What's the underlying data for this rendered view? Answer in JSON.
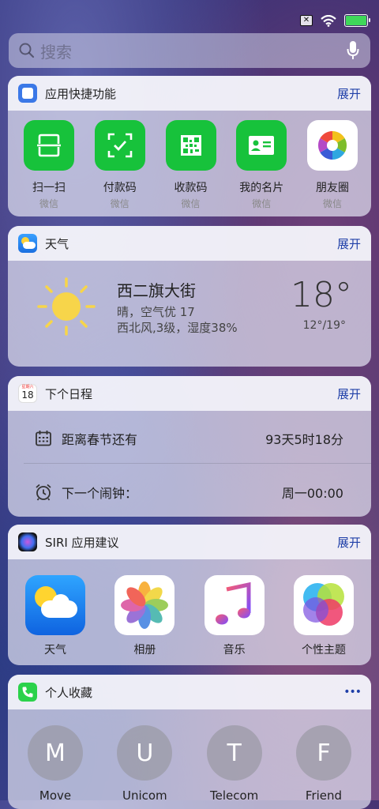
{
  "status_bar": {
    "sim_icon": "sim-disabled-icon",
    "wifi_icon": "wifi-icon",
    "battery_color": "#3fd75a"
  },
  "search": {
    "placeholder": "搜索"
  },
  "shortcuts": {
    "title": "应用快捷功能",
    "expand": "展开",
    "apps": [
      {
        "label": "扫一扫",
        "sub": "微信",
        "icon": "scan-icon"
      },
      {
        "label": "付款码",
        "sub": "微信",
        "icon": "payment-code-icon"
      },
      {
        "label": "收款码",
        "sub": "微信",
        "icon": "qr-code-icon"
      },
      {
        "label": "我的名片",
        "sub": "微信",
        "icon": "business-card-icon"
      },
      {
        "label": "朋友圈",
        "sub": "微信",
        "icon": "moments-icon"
      }
    ]
  },
  "weather": {
    "title": "天气",
    "expand": "展开",
    "location": "西二旗大街",
    "condition": "晴，空气优 17",
    "wind": "西北风,3级，湿度38%",
    "temperature": "18°",
    "range": "12°/19°"
  },
  "schedule": {
    "title": "下个日程",
    "expand": "展开",
    "calendar_day": "18",
    "calendar_weekday": "星期六",
    "event_label": "距离春节还有",
    "event_value": "93天5时18分",
    "alarm_label": "下一个闹钟：",
    "alarm_value": "周一00:00"
  },
  "siri": {
    "title": "SIRI 应用建议",
    "expand": "展开",
    "apps": [
      {
        "label": "天气",
        "icon": "weather-app-icon"
      },
      {
        "label": "相册",
        "icon": "photos-app-icon"
      },
      {
        "label": "音乐",
        "icon": "music-app-icon"
      },
      {
        "label": "个性主题",
        "icon": "themes-app-icon"
      }
    ]
  },
  "favorites": {
    "title": "个人收藏",
    "more": "•••",
    "contacts": [
      {
        "initial": "M",
        "name": "Move"
      },
      {
        "initial": "U",
        "name": "Unicom"
      },
      {
        "initial": "T",
        "name": "Telecom"
      },
      {
        "initial": "F",
        "name": "Friend"
      }
    ]
  }
}
